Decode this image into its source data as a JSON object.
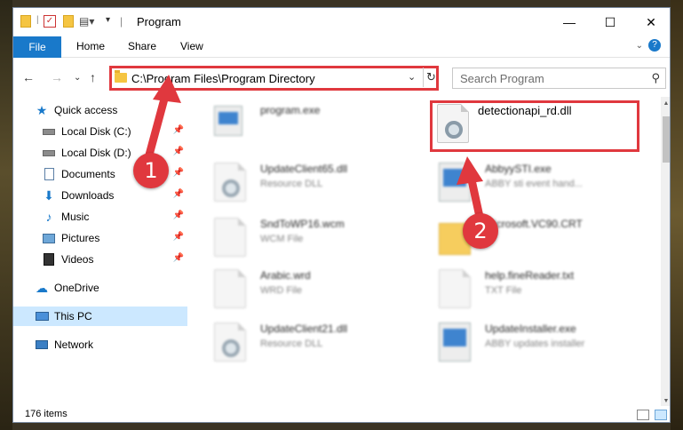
{
  "window": {
    "title": "Program",
    "minimize": "—",
    "maximize": "☐",
    "close": "✕"
  },
  "ribbon": {
    "tabs": [
      "File",
      "Home",
      "Share",
      "View"
    ]
  },
  "address": {
    "path": "C:\\Program Files\\Program Directory",
    "search_placeholder": "Search Program"
  },
  "sidebar": {
    "items": [
      {
        "label": "Quick access",
        "icon": "star-icon"
      },
      {
        "label": "Local Disk (C:)",
        "icon": "drive-icon",
        "pinned": true
      },
      {
        "label": "Local Disk (D:)",
        "icon": "drive-icon",
        "pinned": true
      },
      {
        "label": "Documents",
        "icon": "documents-icon",
        "pinned": true
      },
      {
        "label": "Downloads",
        "icon": "download-icon",
        "pinned": true
      },
      {
        "label": "Music",
        "icon": "music-icon",
        "pinned": true
      },
      {
        "label": "Pictures",
        "icon": "pictures-icon",
        "pinned": true
      },
      {
        "label": "Videos",
        "icon": "videos-icon",
        "pinned": true
      },
      {
        "label": "OneDrive",
        "icon": "cloud-icon"
      },
      {
        "label": "This PC",
        "icon": "computer-icon",
        "selected": true
      },
      {
        "label": "Network",
        "icon": "network-icon"
      }
    ]
  },
  "files": [
    {
      "name": "program.exe",
      "type": "",
      "icon": "installer-icon"
    },
    {
      "name": "detectionapi_rd.dll",
      "type": "",
      "icon": "dll-icon"
    },
    {
      "name": "UpdateClient65.dll",
      "type": "Resource DLL",
      "icon": "dll-icon"
    },
    {
      "name": "AbbyySTI.exe",
      "type": "ABBY sti event hand...",
      "icon": "app-icon"
    },
    {
      "name": "SndToWP16.wcm",
      "type": "WCM File",
      "icon": "document-icon"
    },
    {
      "name": "Microsoft.VC90.CRT",
      "type": "",
      "icon": "folder-icon"
    },
    {
      "name": "Arabic.wrd",
      "type": "WRD File",
      "icon": "document-icon"
    },
    {
      "name": "help.fineReader.txt",
      "type": "TXT File",
      "icon": "document-icon"
    },
    {
      "name": "UpdateClient21.dll",
      "type": "Resource DLL",
      "icon": "dll-icon"
    },
    {
      "name": "UpdateInstaller.exe",
      "type": "ABBY updates installer",
      "icon": "app-icon"
    }
  ],
  "status": {
    "item_count": "176 items"
  },
  "annotations": {
    "step1": "1",
    "step2": "2"
  },
  "colors": {
    "accent": "#1979ca",
    "highlight": "#e0383e",
    "selection": "#cce8ff"
  }
}
